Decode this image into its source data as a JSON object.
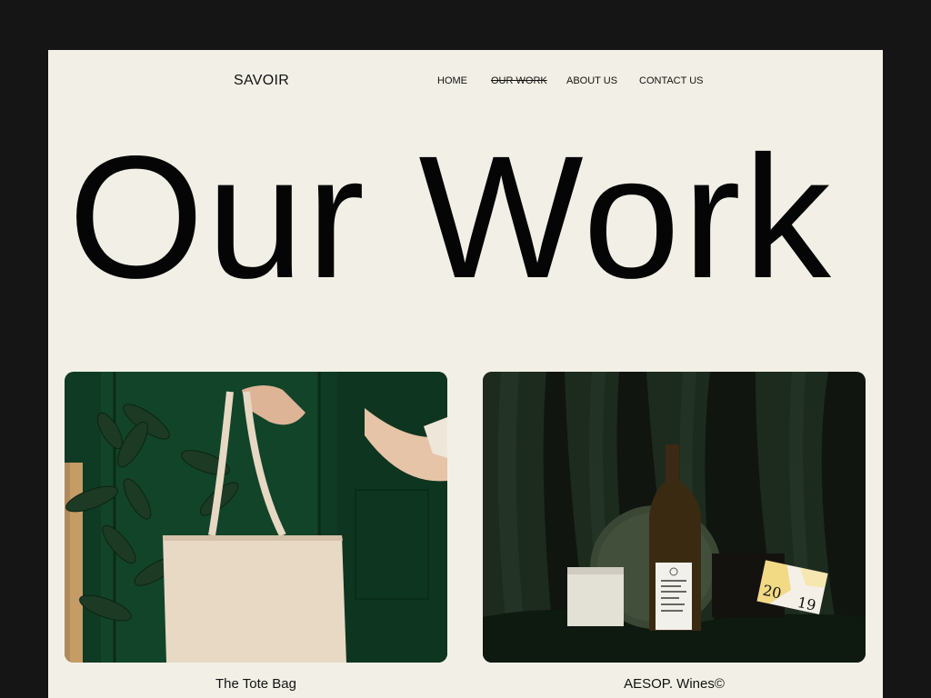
{
  "brand": {
    "logo": "SAVOIR"
  },
  "nav": {
    "items": [
      {
        "label": "HOME"
      },
      {
        "label": "OUR WORK",
        "active": true
      },
      {
        "label": "ABOUT US"
      },
      {
        "label": "CONTACT US"
      }
    ]
  },
  "hero": {
    "title": "Our Work"
  },
  "projects": [
    {
      "caption": "The Tote Bag",
      "image": "tote-bag-photo"
    },
    {
      "caption": "AESOP. Wines©",
      "image": "wine-bottle-photo",
      "card_year_top": "20",
      "card_year_bottom": "19"
    }
  ],
  "colors": {
    "page": "#f2f0e6",
    "frame": "#151515",
    "text": "#050505"
  }
}
